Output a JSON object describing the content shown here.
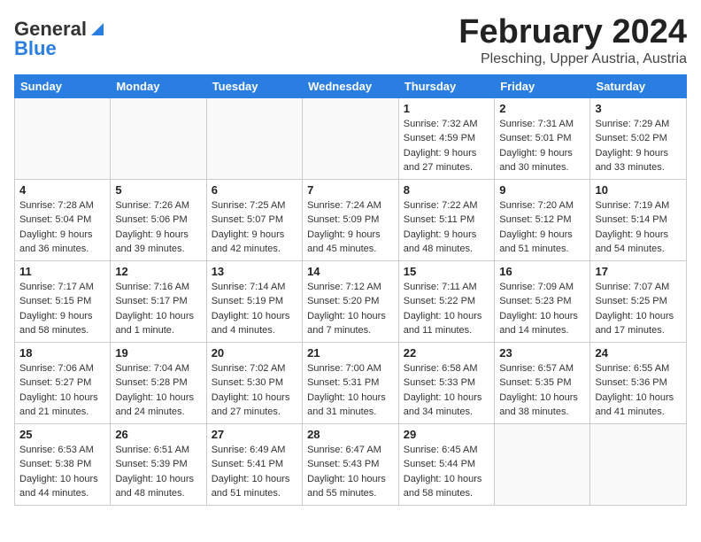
{
  "header": {
    "logo_general": "General",
    "logo_blue": "Blue",
    "month_title": "February 2024",
    "location": "Plesching, Upper Austria, Austria"
  },
  "columns": [
    "Sunday",
    "Monday",
    "Tuesday",
    "Wednesday",
    "Thursday",
    "Friday",
    "Saturday"
  ],
  "weeks": [
    [
      {
        "day": "",
        "info": ""
      },
      {
        "day": "",
        "info": ""
      },
      {
        "day": "",
        "info": ""
      },
      {
        "day": "",
        "info": ""
      },
      {
        "day": "1",
        "info": "Sunrise: 7:32 AM\nSunset: 4:59 PM\nDaylight: 9 hours\nand 27 minutes."
      },
      {
        "day": "2",
        "info": "Sunrise: 7:31 AM\nSunset: 5:01 PM\nDaylight: 9 hours\nand 30 minutes."
      },
      {
        "day": "3",
        "info": "Sunrise: 7:29 AM\nSunset: 5:02 PM\nDaylight: 9 hours\nand 33 minutes."
      }
    ],
    [
      {
        "day": "4",
        "info": "Sunrise: 7:28 AM\nSunset: 5:04 PM\nDaylight: 9 hours\nand 36 minutes."
      },
      {
        "day": "5",
        "info": "Sunrise: 7:26 AM\nSunset: 5:06 PM\nDaylight: 9 hours\nand 39 minutes."
      },
      {
        "day": "6",
        "info": "Sunrise: 7:25 AM\nSunset: 5:07 PM\nDaylight: 9 hours\nand 42 minutes."
      },
      {
        "day": "7",
        "info": "Sunrise: 7:24 AM\nSunset: 5:09 PM\nDaylight: 9 hours\nand 45 minutes."
      },
      {
        "day": "8",
        "info": "Sunrise: 7:22 AM\nSunset: 5:11 PM\nDaylight: 9 hours\nand 48 minutes."
      },
      {
        "day": "9",
        "info": "Sunrise: 7:20 AM\nSunset: 5:12 PM\nDaylight: 9 hours\nand 51 minutes."
      },
      {
        "day": "10",
        "info": "Sunrise: 7:19 AM\nSunset: 5:14 PM\nDaylight: 9 hours\nand 54 minutes."
      }
    ],
    [
      {
        "day": "11",
        "info": "Sunrise: 7:17 AM\nSunset: 5:15 PM\nDaylight: 9 hours\nand 58 minutes."
      },
      {
        "day": "12",
        "info": "Sunrise: 7:16 AM\nSunset: 5:17 PM\nDaylight: 10 hours\nand 1 minute."
      },
      {
        "day": "13",
        "info": "Sunrise: 7:14 AM\nSunset: 5:19 PM\nDaylight: 10 hours\nand 4 minutes."
      },
      {
        "day": "14",
        "info": "Sunrise: 7:12 AM\nSunset: 5:20 PM\nDaylight: 10 hours\nand 7 minutes."
      },
      {
        "day": "15",
        "info": "Sunrise: 7:11 AM\nSunset: 5:22 PM\nDaylight: 10 hours\nand 11 minutes."
      },
      {
        "day": "16",
        "info": "Sunrise: 7:09 AM\nSunset: 5:23 PM\nDaylight: 10 hours\nand 14 minutes."
      },
      {
        "day": "17",
        "info": "Sunrise: 7:07 AM\nSunset: 5:25 PM\nDaylight: 10 hours\nand 17 minutes."
      }
    ],
    [
      {
        "day": "18",
        "info": "Sunrise: 7:06 AM\nSunset: 5:27 PM\nDaylight: 10 hours\nand 21 minutes."
      },
      {
        "day": "19",
        "info": "Sunrise: 7:04 AM\nSunset: 5:28 PM\nDaylight: 10 hours\nand 24 minutes."
      },
      {
        "day": "20",
        "info": "Sunrise: 7:02 AM\nSunset: 5:30 PM\nDaylight: 10 hours\nand 27 minutes."
      },
      {
        "day": "21",
        "info": "Sunrise: 7:00 AM\nSunset: 5:31 PM\nDaylight: 10 hours\nand 31 minutes."
      },
      {
        "day": "22",
        "info": "Sunrise: 6:58 AM\nSunset: 5:33 PM\nDaylight: 10 hours\nand 34 minutes."
      },
      {
        "day": "23",
        "info": "Sunrise: 6:57 AM\nSunset: 5:35 PM\nDaylight: 10 hours\nand 38 minutes."
      },
      {
        "day": "24",
        "info": "Sunrise: 6:55 AM\nSunset: 5:36 PM\nDaylight: 10 hours\nand 41 minutes."
      }
    ],
    [
      {
        "day": "25",
        "info": "Sunrise: 6:53 AM\nSunset: 5:38 PM\nDaylight: 10 hours\nand 44 minutes."
      },
      {
        "day": "26",
        "info": "Sunrise: 6:51 AM\nSunset: 5:39 PM\nDaylight: 10 hours\nand 48 minutes."
      },
      {
        "day": "27",
        "info": "Sunrise: 6:49 AM\nSunset: 5:41 PM\nDaylight: 10 hours\nand 51 minutes."
      },
      {
        "day": "28",
        "info": "Sunrise: 6:47 AM\nSunset: 5:43 PM\nDaylight: 10 hours\nand 55 minutes."
      },
      {
        "day": "29",
        "info": "Sunrise: 6:45 AM\nSunset: 5:44 PM\nDaylight: 10 hours\nand 58 minutes."
      },
      {
        "day": "",
        "info": ""
      },
      {
        "day": "",
        "info": ""
      }
    ]
  ]
}
